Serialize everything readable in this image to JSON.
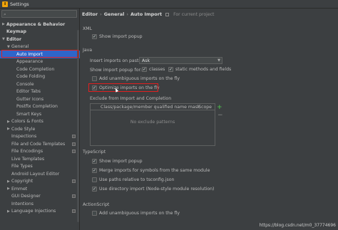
{
  "window": {
    "title": "Settings"
  },
  "sidebar": {
    "search_placeholder": "",
    "items": [
      {
        "label": "Appearance & Behavior",
        "arrow": "▶",
        "bold": true,
        "indent": 0
      },
      {
        "label": "Keymap",
        "arrow": "",
        "bold": true,
        "indent": 0
      },
      {
        "label": "Editor",
        "arrow": "▼",
        "bold": true,
        "indent": 0
      },
      {
        "label": "General",
        "arrow": "▼",
        "bold": false,
        "indent": 1
      },
      {
        "label": "Auto Import",
        "arrow": "",
        "bold": false,
        "indent": 2,
        "selected": true
      },
      {
        "label": "Appearance",
        "arrow": "",
        "bold": false,
        "indent": 2
      },
      {
        "label": "Code Completion",
        "arrow": "",
        "bold": false,
        "indent": 2
      },
      {
        "label": "Code Folding",
        "arrow": "",
        "bold": false,
        "indent": 2
      },
      {
        "label": "Console",
        "arrow": "",
        "bold": false,
        "indent": 2
      },
      {
        "label": "Editor Tabs",
        "arrow": "",
        "bold": false,
        "indent": 2
      },
      {
        "label": "Gutter Icons",
        "arrow": "",
        "bold": false,
        "indent": 2
      },
      {
        "label": "Postfix Completion",
        "arrow": "",
        "bold": false,
        "indent": 2
      },
      {
        "label": "Smart Keys",
        "arrow": "",
        "bold": false,
        "indent": 2
      },
      {
        "label": "Colors & Fonts",
        "arrow": "▶",
        "bold": false,
        "indent": 1
      },
      {
        "label": "Code Style",
        "arrow": "▶",
        "bold": false,
        "indent": 1
      },
      {
        "label": "Inspections",
        "arrow": "",
        "bold": false,
        "indent": 1,
        "project": true
      },
      {
        "label": "File and Code Templates",
        "arrow": "",
        "bold": false,
        "indent": 1,
        "project": true
      },
      {
        "label": "File Encodings",
        "arrow": "",
        "bold": false,
        "indent": 1,
        "project": true
      },
      {
        "label": "Live Templates",
        "arrow": "",
        "bold": false,
        "indent": 1
      },
      {
        "label": "File Types",
        "arrow": "",
        "bold": false,
        "indent": 1
      },
      {
        "label": "Android Layout Editor",
        "arrow": "",
        "bold": false,
        "indent": 1
      },
      {
        "label": "Copyright",
        "arrow": "▶",
        "bold": false,
        "indent": 1,
        "project": true
      },
      {
        "label": "Emmet",
        "arrow": "▶",
        "bold": false,
        "indent": 1
      },
      {
        "label": "GUI Designer",
        "arrow": "",
        "bold": false,
        "indent": 1,
        "project": true
      },
      {
        "label": "Intentions",
        "arrow": "",
        "bold": false,
        "indent": 1
      },
      {
        "label": "Language Injections",
        "arrow": "▶",
        "bold": false,
        "indent": 1,
        "project": true
      }
    ]
  },
  "breadcrumb": {
    "part1": "Editor",
    "sep1": "›",
    "part2": "General",
    "sep2": "›",
    "part3": "Auto Import",
    "for_project": "For current project"
  },
  "xml": {
    "section": "XML",
    "show_import_popup": {
      "label": "Show import popup",
      "checked": true
    }
  },
  "java": {
    "section": "Java",
    "insert_on_paste_label": "Insert imports on paste:",
    "insert_on_paste_value": "Ask",
    "show_popup_for_label": "Show import popup for:",
    "classes": {
      "label": "classes",
      "checked": true
    },
    "static_methods": {
      "label": "static methods and fields",
      "checked": true
    },
    "add_unambiguous": {
      "label": "Add unambiguous imports on the fly",
      "checked": false
    },
    "optimize_imports": {
      "label": "Optimize imports on the fly",
      "checked": true
    },
    "exclude_label": "Exclude from Import and Completion",
    "table_col1": "Class/package/member qualified name mask",
    "table_col2": "Scope",
    "table_empty": "No exclude patterns",
    "add_btn": "+",
    "remove_btn": "−"
  },
  "typescript": {
    "section": "TypeScript",
    "show_import_popup": {
      "label": "Show import popup",
      "checked": true
    },
    "merge_imports": {
      "label": "Merge imports for symbols from the same module",
      "checked": true
    },
    "use_paths": {
      "label": "Use paths relative to tsconfig.json",
      "checked": false
    },
    "use_directory": {
      "label": "Use directory import (Node-style module resolution)",
      "checked": true
    }
  },
  "actionscript": {
    "section": "ActionScript",
    "add_unambiguous": {
      "label": "Add unambiguous imports on the fly",
      "checked": false
    }
  },
  "watermark": "https://blog.csdn.net/m0_37774696",
  "colors": {
    "selection": "#2f65ca",
    "highlight_box": "#e02020",
    "background": "#3c3f41"
  }
}
